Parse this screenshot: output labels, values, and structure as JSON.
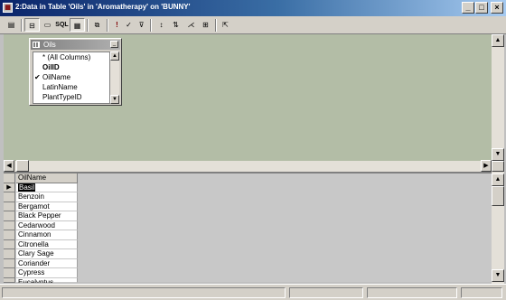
{
  "window": {
    "title": "2:Data in Table 'Oils' in 'Aromatherapy' on 'BUNNY'",
    "icon": "query-designer-icon",
    "buttons": {
      "minimize": "_",
      "maximize": "□",
      "close": "×"
    }
  },
  "toolbar": {
    "buttons": [
      "show-diagram-pane",
      "show-grid-pane",
      "show-sql-pane",
      "show-results-pane",
      "change-type",
      "run",
      "verify-sql",
      "remove-filter",
      "sort-ascending",
      "sort-descending",
      "add-table"
    ],
    "sql_label": "SQL"
  },
  "diagram": {
    "table": {
      "name": "Oils",
      "columns": [
        {
          "label": "* (All Columns)",
          "checked": false,
          "key": false
        },
        {
          "label": "OilID",
          "checked": false,
          "key": true
        },
        {
          "label": "OilName",
          "checked": true,
          "key": false
        },
        {
          "label": "LatinName",
          "checked": false,
          "key": false
        },
        {
          "label": "PlantTypeID",
          "checked": false,
          "key": false
        }
      ]
    }
  },
  "grid": {
    "column_header": "OilName",
    "current_row_marker": "▶",
    "rows": [
      "Basil",
      "Benzoin",
      "Bergamot",
      "Black Pepper",
      "Cedarwood",
      "Cinnamon",
      "Citronella",
      "Clary Sage",
      "Coriander",
      "Cypress",
      "Eucalyptus"
    ]
  }
}
